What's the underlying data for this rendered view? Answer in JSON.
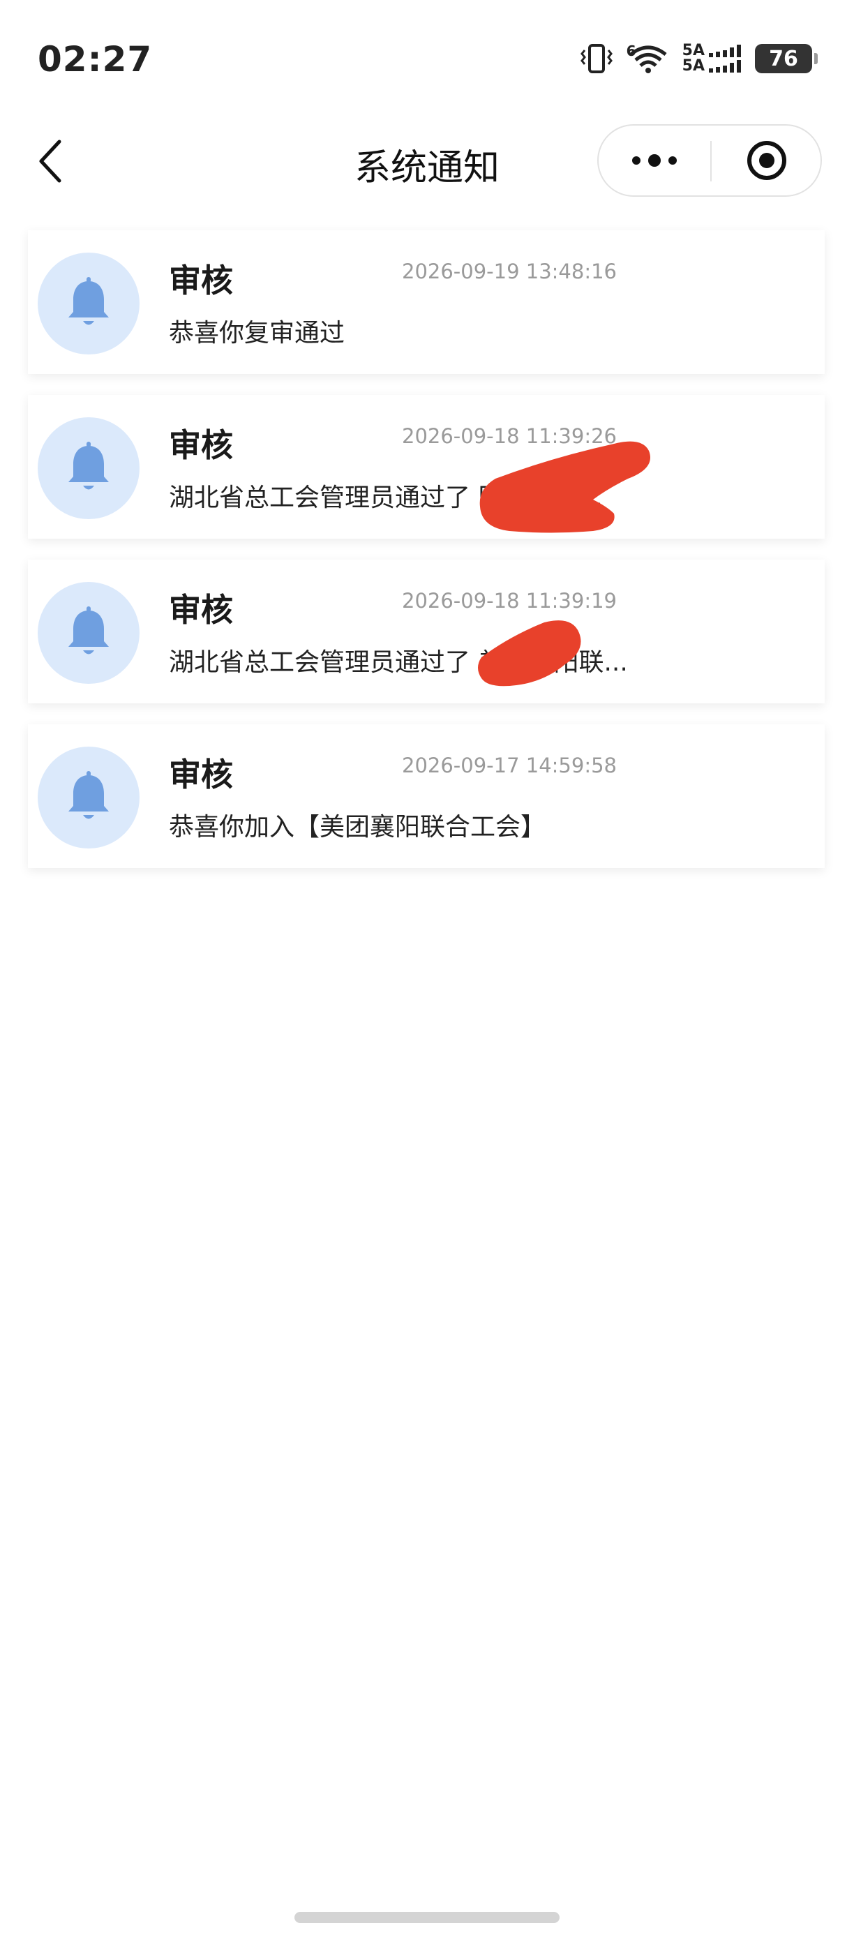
{
  "status_bar": {
    "time": "02:27",
    "network_label_top": "5A",
    "network_label_bottom": "5A",
    "wifi_label": "6",
    "battery": "76"
  },
  "nav": {
    "title": "系统通知"
  },
  "notices": [
    {
      "title": "审核",
      "time": "2026-09-19 13:48:16",
      "content": "恭喜你复审通过"
    },
    {
      "title": "审核",
      "time": "2026-09-18 11:39:26",
      "content": "湖北省总工会管理员通过了          团襄阳联..."
    },
    {
      "title": "审核",
      "time": "2026-09-18 11:39:19",
      "content": "湖北省总工会管理员通过了     美团襄阳联..."
    },
    {
      "title": "审核",
      "time": "2026-09-17 14:59:58",
      "content": "恭喜你加入【美团襄阳联合工会】"
    }
  ],
  "colors": {
    "bell": "#6f9fe0",
    "avatar_bg": "#dbe9fb",
    "redaction": "#e8412b"
  },
  "icons": {
    "back": "chevron-left-icon",
    "more": "more-dots-icon",
    "close": "target-close-icon",
    "bell": "bell-icon"
  }
}
